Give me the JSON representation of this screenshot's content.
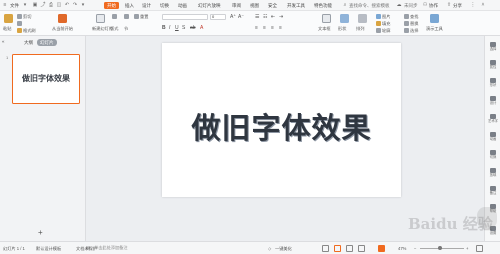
{
  "menu": {
    "file": "文件",
    "items": [
      {
        "label": "开始",
        "active": true
      },
      {
        "label": "插入"
      },
      {
        "label": "设计"
      },
      {
        "label": "切换"
      },
      {
        "label": "动画"
      },
      {
        "label": "幻灯片放映"
      },
      {
        "label": "审阅"
      },
      {
        "label": "视图"
      },
      {
        "label": "安全"
      },
      {
        "label": "开发工具"
      },
      {
        "label": "特色功能"
      }
    ],
    "search_placeholder": "查找命令、搜索模板",
    "sync": "未同步",
    "collab": "协作",
    "share": "分享"
  },
  "toolbar": {
    "paste": "粘贴",
    "cut": "剪切",
    "format_painter": "格式刷",
    "from_current": "从当前开始",
    "new_slide": "新建幻灯片",
    "layout": "版式",
    "section": "节",
    "reset": "重置",
    "font_size": "0",
    "textbox": "文本框",
    "shape": "形状",
    "arrange": "排列",
    "picture": "图片",
    "fill": "填充",
    "find": "查找",
    "replace": "替换",
    "select": "选择",
    "outline": "轮廓",
    "chart_styles": "演示工具"
  },
  "left_panel": {
    "tab_outline": "大纲",
    "tab_slides": "幻灯片",
    "slide_number": "1",
    "thumbnail_text": "做旧字体效果",
    "add_label": "+"
  },
  "slide": {
    "title": "做旧字体效果"
  },
  "right_sidebar": [
    {
      "label": "选择"
    },
    {
      "label": "属性"
    },
    {
      "label": "形状"
    },
    {
      "label": "设计"
    },
    {
      "label": "艺术字"
    },
    {
      "label": "动画"
    },
    {
      "label": "切换"
    },
    {
      "label": "放映"
    },
    {
      "label": "备注"
    },
    {
      "label": "帮助"
    },
    {
      "label": "设置"
    }
  ],
  "notes_placeholder": "单击此处添加备注",
  "status": {
    "slide_info": "幻灯片 1 / 1",
    "theme": "默认设计模板",
    "protect": "文档未保护",
    "beautify": "一键美化",
    "zoom": "47%"
  },
  "watermark": {
    "text": "Baidu 经验"
  },
  "colors": {
    "accent": "#f06a1f",
    "title_text": "#2f3640"
  }
}
